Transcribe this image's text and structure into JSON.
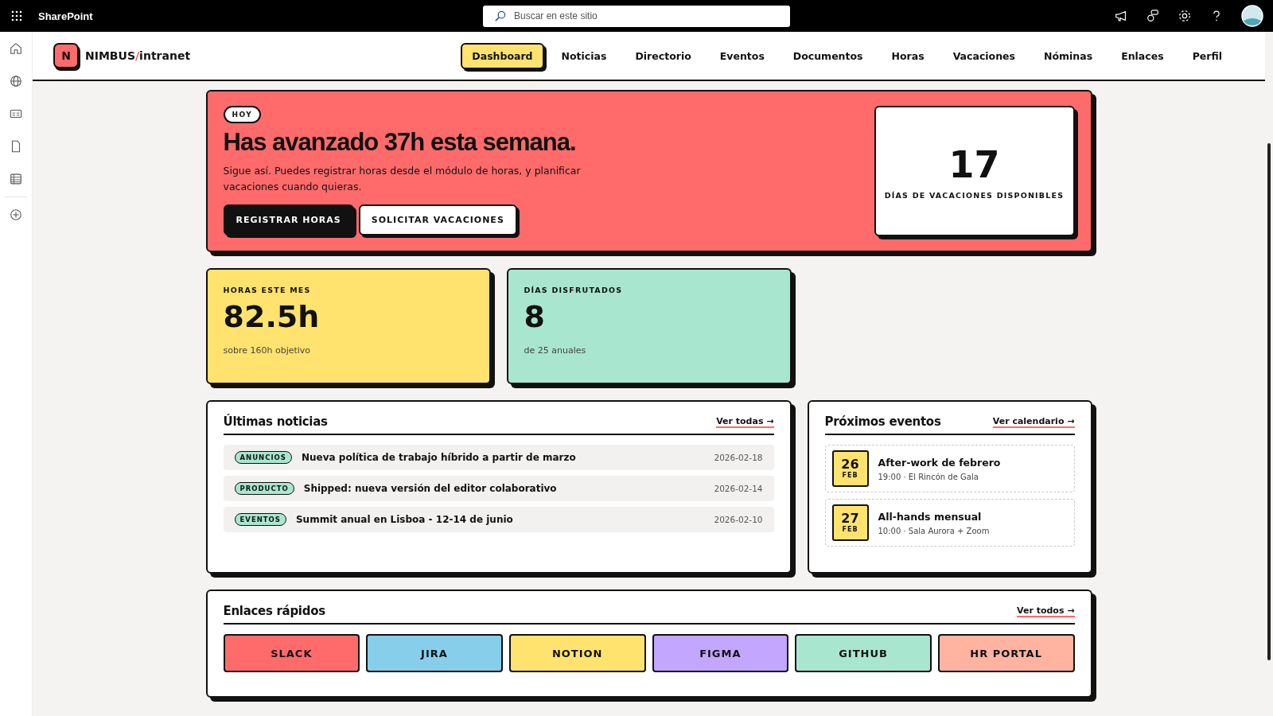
{
  "suite_bar": {
    "app_name": "SharePoint",
    "search": {
      "placeholder": "Buscar en este sitio"
    }
  },
  "site_header": {
    "logo_letter": "N",
    "logo_name": "NIMBUS",
    "logo_slash": "/",
    "logo_suffix": "intranet",
    "nav": [
      {
        "label": "Dashboard",
        "selected": true
      },
      {
        "label": "Noticias",
        "selected": false
      },
      {
        "label": "Directorio",
        "selected": false
      },
      {
        "label": "Eventos",
        "selected": false
      },
      {
        "label": "Documentos",
        "selected": false
      },
      {
        "label": "Horas",
        "selected": false
      },
      {
        "label": "Vacaciones",
        "selected": false
      },
      {
        "label": "Nóminas",
        "selected": false
      },
      {
        "label": "Enlaces",
        "selected": false
      },
      {
        "label": "Perfil",
        "selected": false
      }
    ]
  },
  "hero": {
    "badge": "HOY",
    "title": "Has avanzado 37h esta semana.",
    "text": "Sigue así. Puedes registrar horas desde el módulo de horas, y planificar vacaciones cuando quieras.",
    "buttons": [
      {
        "label": "REGISTRAR HORAS",
        "kind": "primary"
      },
      {
        "label": "SOLICITAR VACACIONES",
        "kind": "secondary"
      }
    ],
    "stat": {
      "value": "17",
      "label": "DÍAS DE VACACIONES DISPONIBLES"
    }
  },
  "stats": [
    {
      "label": "HORAS ESTE MES",
      "value": "82.5h",
      "note": "sobre 160h objetivo",
      "color": "#ffe36e"
    },
    {
      "label": "DÍAS DISFRUTADOS",
      "value": "8",
      "note": "de 25 anuales",
      "color": "#a8e6cf"
    }
  ],
  "news": {
    "title": "Últimas noticias",
    "link": "Ver todas →",
    "items": [
      {
        "tag": "ANUNCIOS",
        "title": "Nueva política de trabajo híbrido a partir de marzo",
        "date": "2026-02-18"
      },
      {
        "tag": "PRODUCTO",
        "title": "Shipped: nueva versión del editor colaborativo",
        "date": "2026-02-14"
      },
      {
        "tag": "EVENTOS",
        "title": "Summit anual en Lisboa - 12-14 de junio",
        "date": "2026-02-10"
      }
    ]
  },
  "events": {
    "title": "Próximos eventos",
    "link": "Ver calendario →",
    "items": [
      {
        "day": "26",
        "month": "FEB",
        "title": "After-work de febrero",
        "details": "19:00 · El Rincón de Gala"
      },
      {
        "day": "27",
        "month": "FEB",
        "title": "All-hands mensual",
        "details": "10:00 · Sala Aurora + Zoom"
      }
    ]
  },
  "quick_links": {
    "title": "Enlaces rápidos",
    "link": "Ver todos →",
    "items": [
      {
        "label": "SLACK",
        "color": "#ff6b6b"
      },
      {
        "label": "JIRA",
        "color": "#87ceeb"
      },
      {
        "label": "NOTION",
        "color": "#ffe36e"
      },
      {
        "label": "FIGMA",
        "color": "#c3a6ff"
      },
      {
        "label": "GITHUB",
        "color": "#a8e6cf"
      },
      {
        "label": "HR PORTAL",
        "color": "#ffb3a0"
      }
    ]
  }
}
